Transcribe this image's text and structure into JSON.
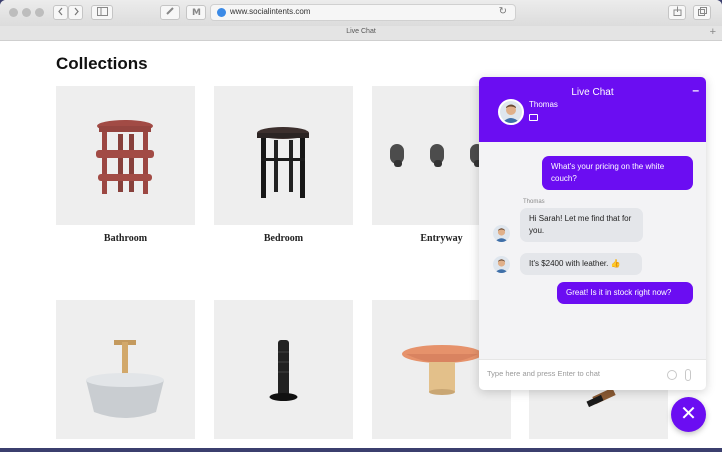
{
  "browser": {
    "url": "www.socialintents.com",
    "tab_title": "Live Chat",
    "back_icon": "chevron-left",
    "forward_icon": "chevron-right",
    "reload_icon": "reload",
    "new_tab_label": "+"
  },
  "page": {
    "title": "Collections",
    "collections": [
      {
        "label": "Bathroom"
      },
      {
        "label": "Bedroom"
      },
      {
        "label": "Entryway"
      },
      {
        "label": ""
      },
      {
        "label": ""
      },
      {
        "label": ""
      },
      {
        "label": ""
      }
    ]
  },
  "chat": {
    "title": "Live Chat",
    "minimize_label": "–",
    "agent_name": "Thomas",
    "sender_label": "Thomas",
    "messages": [
      {
        "from": "visitor",
        "text": "What's your pricing on the white couch?"
      },
      {
        "from": "agent",
        "text": "Hi Sarah! Let me find that for you."
      },
      {
        "from": "agent",
        "text": "It's $2400 with leather. 👍"
      },
      {
        "from": "visitor",
        "text": "Great! Is it in stock right now?"
      }
    ],
    "input_placeholder": "Type here and press Enter to chat",
    "close_label": "✕",
    "accent_color": "#6b0df2"
  }
}
